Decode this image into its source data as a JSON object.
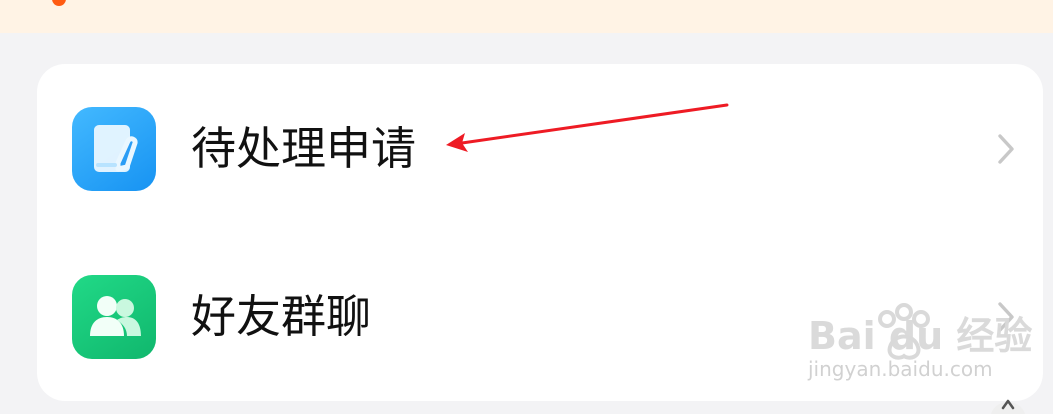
{
  "colors": {
    "background": "#f3f3f5",
    "banner": "#fff3e5",
    "card": "#ffffff",
    "text": "#111111",
    "blue_icon": "#25a8fb",
    "green_icon": "#14c878",
    "annotation_red": "#ee1b24"
  },
  "banner": {
    "icon": "notification-dot-icon"
  },
  "rows": [
    {
      "label": "待处理申请",
      "icon": "edit-document-icon",
      "chevron": "chevron-right-icon"
    },
    {
      "label": "好友群聊",
      "icon": "people-icon",
      "chevron": "chevron-right-icon"
    }
  ],
  "watermark": {
    "brand": "Bai du 经验",
    "site": "jingyan.baidu.com",
    "icon": "baidu-paw-icon"
  },
  "annotation": {
    "type": "arrow",
    "icon": "red-arrow-icon"
  },
  "bottom_control": {
    "icon": "chevron-up-icon"
  }
}
